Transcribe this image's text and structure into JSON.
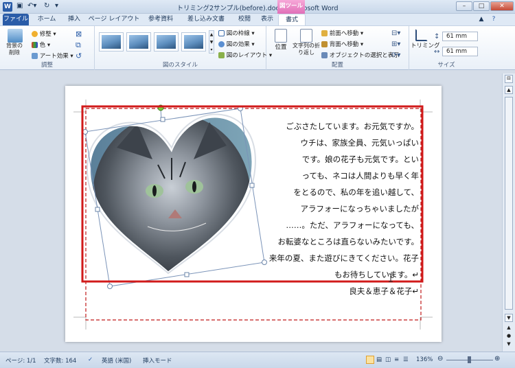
{
  "window": {
    "title": "トリミング2サンプル(before).docx  -  Microsoft Word",
    "context_tab": "図ツール",
    "min": "–",
    "max": "□",
    "close": "✕"
  },
  "tabs": [
    {
      "label": "ファイル"
    },
    {
      "label": "ホーム"
    },
    {
      "label": "挿入"
    },
    {
      "label": "ページ レイアウト"
    },
    {
      "label": "参考資料"
    },
    {
      "label": "差し込み文書"
    },
    {
      "label": "校閲"
    },
    {
      "label": "表示"
    },
    {
      "label": "書式"
    }
  ],
  "ribbon": {
    "adjust": {
      "remove_bg": "背景の削除",
      "corrections": "修整",
      "color": "色",
      "artistic": "アート効果",
      "label": "調整"
    },
    "styles": {
      "border": "図の枠線",
      "effects": "図の効果",
      "layout": "図のレイアウト",
      "label": "図のスタイル"
    },
    "arrange": {
      "position": "位置",
      "wrap": "文字列の折り返し",
      "front": "前面へ移動",
      "back": "背面へ移動",
      "select": "オブジェクトの選択と表示",
      "label": "配置"
    },
    "size": {
      "crop": "トリミング",
      "height": "61 mm",
      "width": "61 mm",
      "label": "サイズ"
    }
  },
  "document": {
    "lines": [
      "ごぶさたしています。お元気ですか。",
      "ウチは、家族全員、元気いっぱい",
      "です。娘の花子も元気です。とい",
      "っても、ネコは人間よりも早く年",
      "をとるので、私の年を追い越して、",
      "アラフォーになっちゃいましたが",
      "……。ただ、アラフォーになっても、",
      "お転婆なところは直らないみたいです。",
      "来年の夏、また遊びにきてください。花子",
      "もお待ちしています。↵"
    ],
    "signature": "良夫＆恵子＆花子↵"
  },
  "status": {
    "page": "ページ: 1/1",
    "words": "文字数: 164",
    "lang": "英語 (米国)",
    "mode": "挿入モード",
    "zoom": "136%"
  },
  "colors": {
    "accent": "#2a5ca8",
    "context": "#e070b8",
    "highlight": "#d11a1a"
  }
}
